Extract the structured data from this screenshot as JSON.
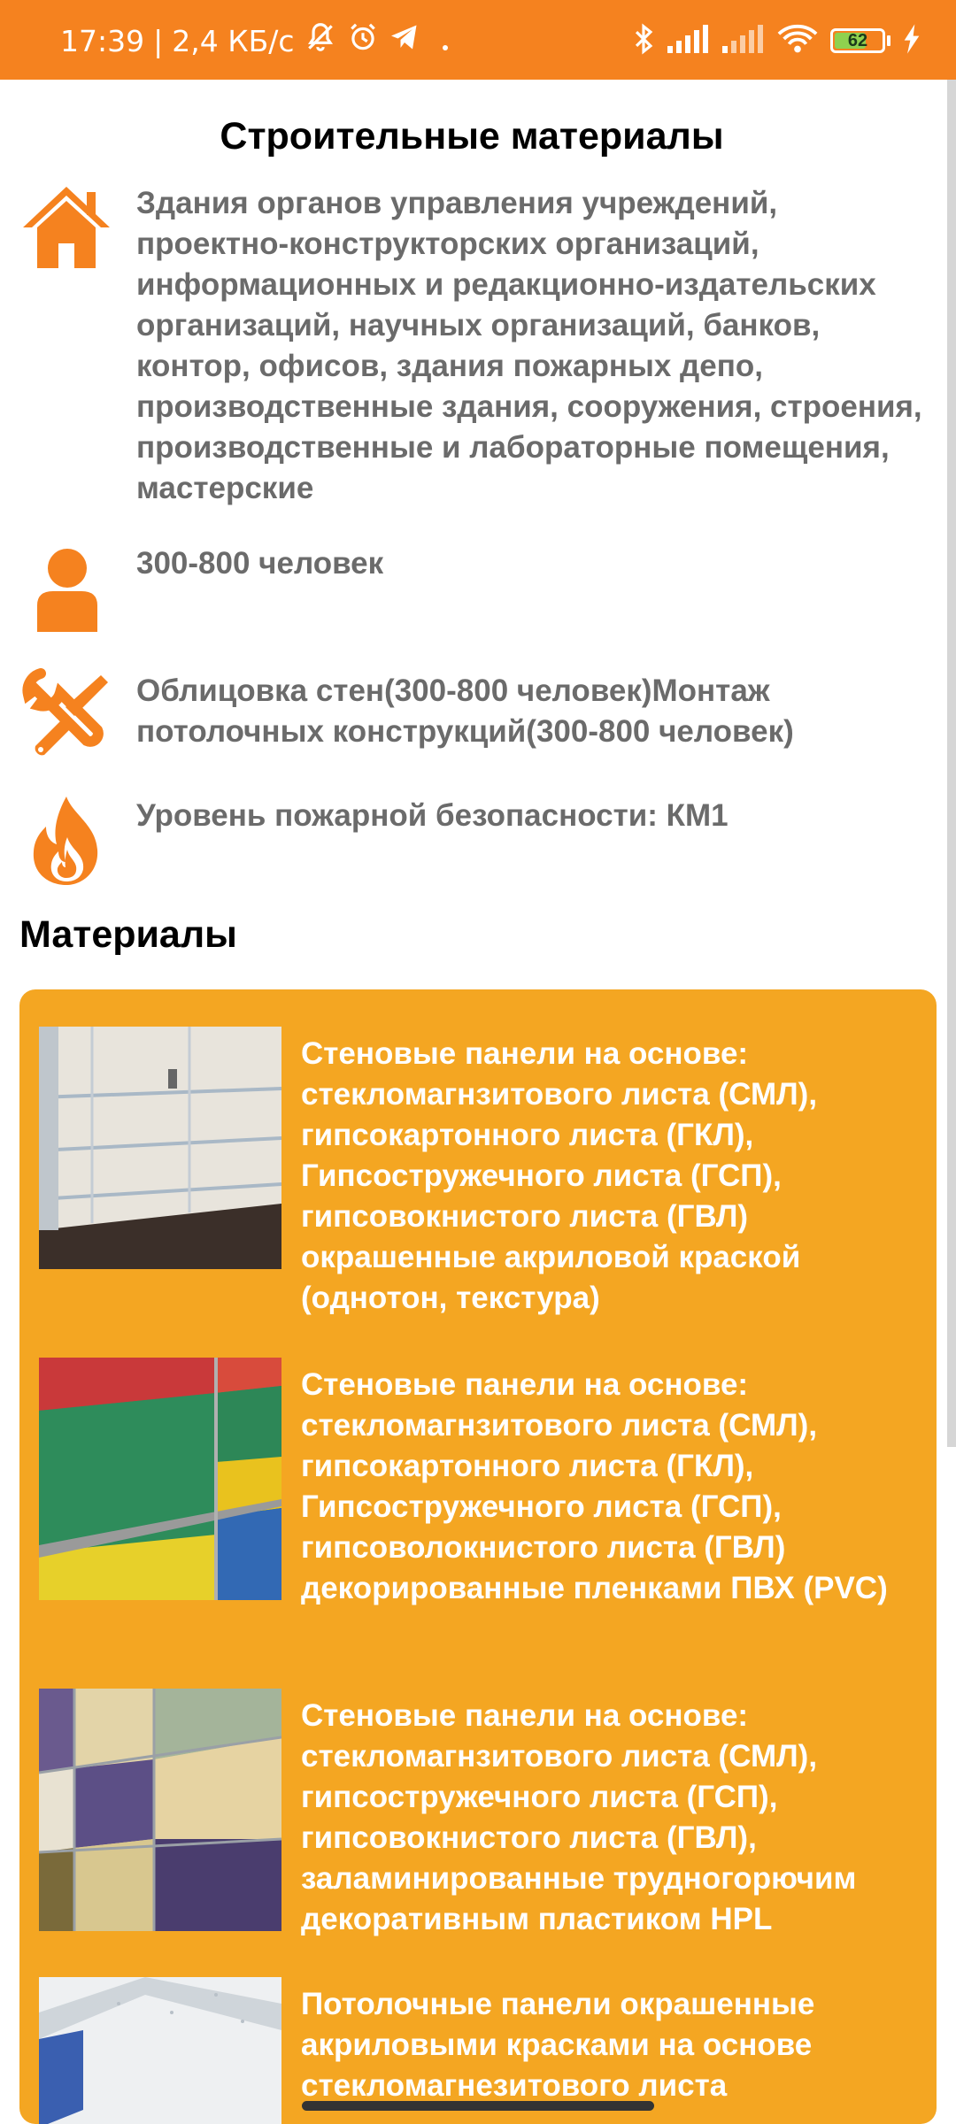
{
  "status_bar": {
    "time": "17:39",
    "separator": "|",
    "speed": "2,4 КБ/с",
    "battery_level": "62",
    "icons": [
      "muted-bell-icon",
      "alarm-icon",
      "telegram-icon",
      "dot-icon",
      "bluetooth-icon",
      "signal-icon",
      "signal-icon",
      "wifi-icon",
      "battery-icon",
      "charging-icon"
    ],
    "background_color": "#f5821f"
  },
  "page": {
    "title": "Строительные материалы"
  },
  "info": {
    "building": {
      "icon": "house-icon",
      "text": "Здания органов управления учреждений, проектно-конструкторских организаций, информационных и редакционно-издательских организаций, научных организаций, банков, контор, офисов, здания пожарных депо, производственные здания, сооружения, строения, производственные и лабораторные помещения, мастерские"
    },
    "people": {
      "icon": "person-icon",
      "text": "300-800 человек"
    },
    "works": {
      "icon": "tools-icon",
      "text": "Облицовка стен(300-800 человек)Монтаж потолочных конструкций(300-800 человек)"
    },
    "fire": {
      "icon": "fire-icon",
      "text": "Уровень пожарной безопасности: КМ1"
    }
  },
  "materials": {
    "title": "Материалы",
    "card_color": "#f4a622",
    "items": [
      {
        "text": "Стеновые панели на основе: стекломагнзитового листа (СМЛ), гипсокартонного листа (ГКЛ), Гипсостружечного листа (ГСП), гипсовокнистого листа (ГВЛ) окрашенные акриловой краской (однотон, текстура)"
      },
      {
        "text": "Стеновые панели на основе: стекломагнзитового листа (СМЛ), гипсокартонного листа (ГКЛ), Гипсостружечного листа (ГСП), гипсоволокнистого листа (ГВЛ) декорированные пленками ПВХ (PVC)"
      },
      {
        "text": "Стеновые панели на основе: стекломагнзитового листа (СМЛ), гипсостружечного листа (ГСП), гипсовокнистого листа (ГВЛ), заламинированные трудногорючим декоративным пластиком HPL"
      },
      {
        "text": "Потолочные панели окрашенные акриловыми красками на основе стекломагнезитового листа"
      }
    ]
  },
  "accent_color": "#f5821f"
}
